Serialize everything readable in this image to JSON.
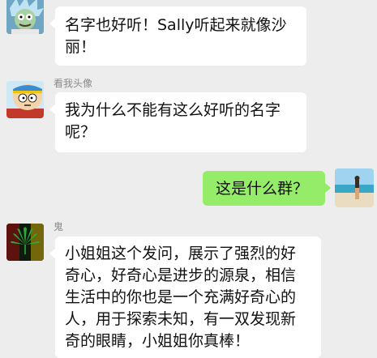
{
  "colors": {
    "chat_background": "#ededed",
    "bubble_incoming": "#ffffff",
    "bubble_outgoing": "#95ec69",
    "sender_name": "#8a8a8a"
  },
  "messages": [
    {
      "sender_name": "",
      "avatar_icon": "cartoon-scientist-avatar-icon",
      "direction": "incoming",
      "text": "名字也好听！Sally听起来就像沙\n丽！"
    },
    {
      "sender_name": "看我头像",
      "avatar_icon": "cartoon-boy-avatar-icon",
      "direction": "incoming",
      "text": "我为什么不能有这么好听的名字\n呢？"
    },
    {
      "sender_name": "",
      "avatar_icon": "beach-photo-avatar-icon",
      "direction": "outgoing",
      "text": "这是什么群？"
    },
    {
      "sender_name": "鬼",
      "avatar_icon": "leaf-avatar-icon",
      "direction": "incoming",
      "text": "小姐姐这个发问，展示了强烈的好\n奇心，好奇心是进步的源泉，相信\n生活中的你也是一个充满好奇心的\n人，用于探索未知，有一双发现新\n奇的眼睛，小姐姐你真棒！"
    }
  ]
}
